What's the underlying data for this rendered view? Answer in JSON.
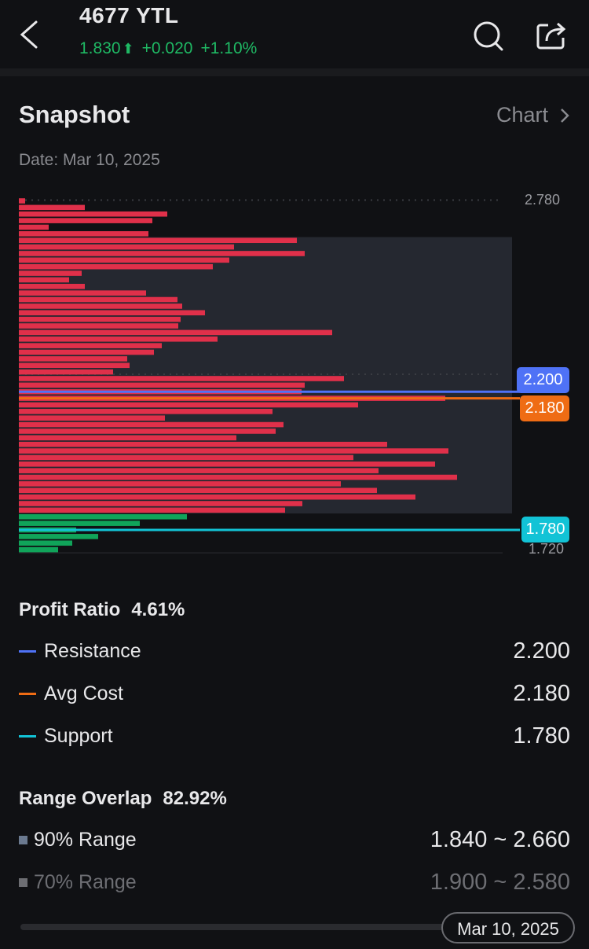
{
  "header": {
    "title": "4677  YTL",
    "price": "1.830",
    "change": "+0.020",
    "change_pct": "+1.10%",
    "direction_icon": "arrow-up-icon",
    "up_color": "#1fb964"
  },
  "snapshot": {
    "title": "Snapshot",
    "chart_link": "Chart",
    "date": "Date: Mar 10, 2025"
  },
  "chart_data": {
    "type": "bar",
    "orientation": "horizontal",
    "description_units": "relative chip volume per price level",
    "price_top": 2.78,
    "price_step": 0.02,
    "axis_labels": {
      "top": "2.780",
      "bottom": "1.720"
    },
    "red_color": "#e0304a",
    "green_color": "#10a45a",
    "red_values": [
      8,
      84,
      189,
      170,
      38,
      165,
      354,
      274,
      364,
      268,
      247,
      80,
      64,
      84,
      162,
      202,
      208,
      237,
      206,
      203,
      399,
      253,
      182,
      172,
      138,
      141,
      120,
      414,
      364,
      360,
      543,
      432,
      323,
      186,
      337,
      327,
      277,
      469,
      547,
      426,
      530,
      458,
      558,
      410,
      456,
      505,
      361,
      339
    ],
    "green_values": [
      214,
      154,
      73,
      101,
      68,
      50
    ],
    "levels": [
      {
        "name": "Resistance",
        "value": 2.2,
        "label": "2.200",
        "color": "#4f72f6"
      },
      {
        "name": "Avg Cost",
        "value": 2.18,
        "label": "2.180",
        "color": "#ef6c14"
      },
      {
        "name": "Support",
        "value": 1.78,
        "label": "1.780",
        "color": "#12c3d6"
      }
    ],
    "range_90": [
      1.84,
      2.66
    ],
    "range_shade_color": "#252830"
  },
  "stats": {
    "profit_ratio_label": "Profit Ratio",
    "profit_ratio": "4.61%",
    "resistance_label": "Resistance",
    "resistance": "2.200",
    "avg_cost_label": "Avg Cost",
    "avg_cost": "2.180",
    "support_label": "Support",
    "support": "1.780",
    "range_overlap_label": "Range Overlap",
    "range_overlap": "82.92%",
    "range90_label": "90% Range",
    "range90": "1.840 ~ 2.660",
    "range70_label": "70% Range",
    "range70": "1.900 ~ 2.580"
  },
  "timeline": {
    "date": "Mar 10, 2025"
  }
}
